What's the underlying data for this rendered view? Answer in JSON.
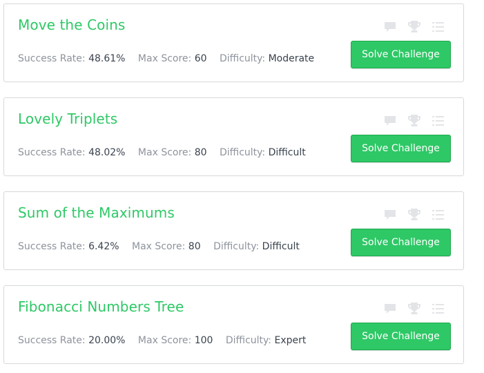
{
  "labels": {
    "success_rate": "Success Rate:",
    "max_score": "Max Score:",
    "difficulty": "Difficulty:",
    "solve_button": "Solve Challenge"
  },
  "icons": [
    "discussion-icon",
    "leaderboard-trophy-icon",
    "submissions-list-icon"
  ],
  "colors": {
    "title_green": "#2ec866",
    "button_green": "#2ec866",
    "button_border": "#1ba94c",
    "label_gray": "#8d939c",
    "value_dark": "#39424e",
    "icon_gray": "#e2e4e7",
    "card_border": "#d5d8db"
  },
  "challenges": [
    {
      "title": "Move the Coins",
      "success_rate": "48.61%",
      "max_score": "60",
      "difficulty": "Moderate"
    },
    {
      "title": "Lovely Triplets",
      "success_rate": "48.02%",
      "max_score": "80",
      "difficulty": "Difficult"
    },
    {
      "title": "Sum of the Maximums",
      "success_rate": "6.42%",
      "max_score": "80",
      "difficulty": "Difficult"
    },
    {
      "title": "Fibonacci Numbers Tree",
      "success_rate": "20.00%",
      "max_score": "100",
      "difficulty": "Expert"
    }
  ]
}
